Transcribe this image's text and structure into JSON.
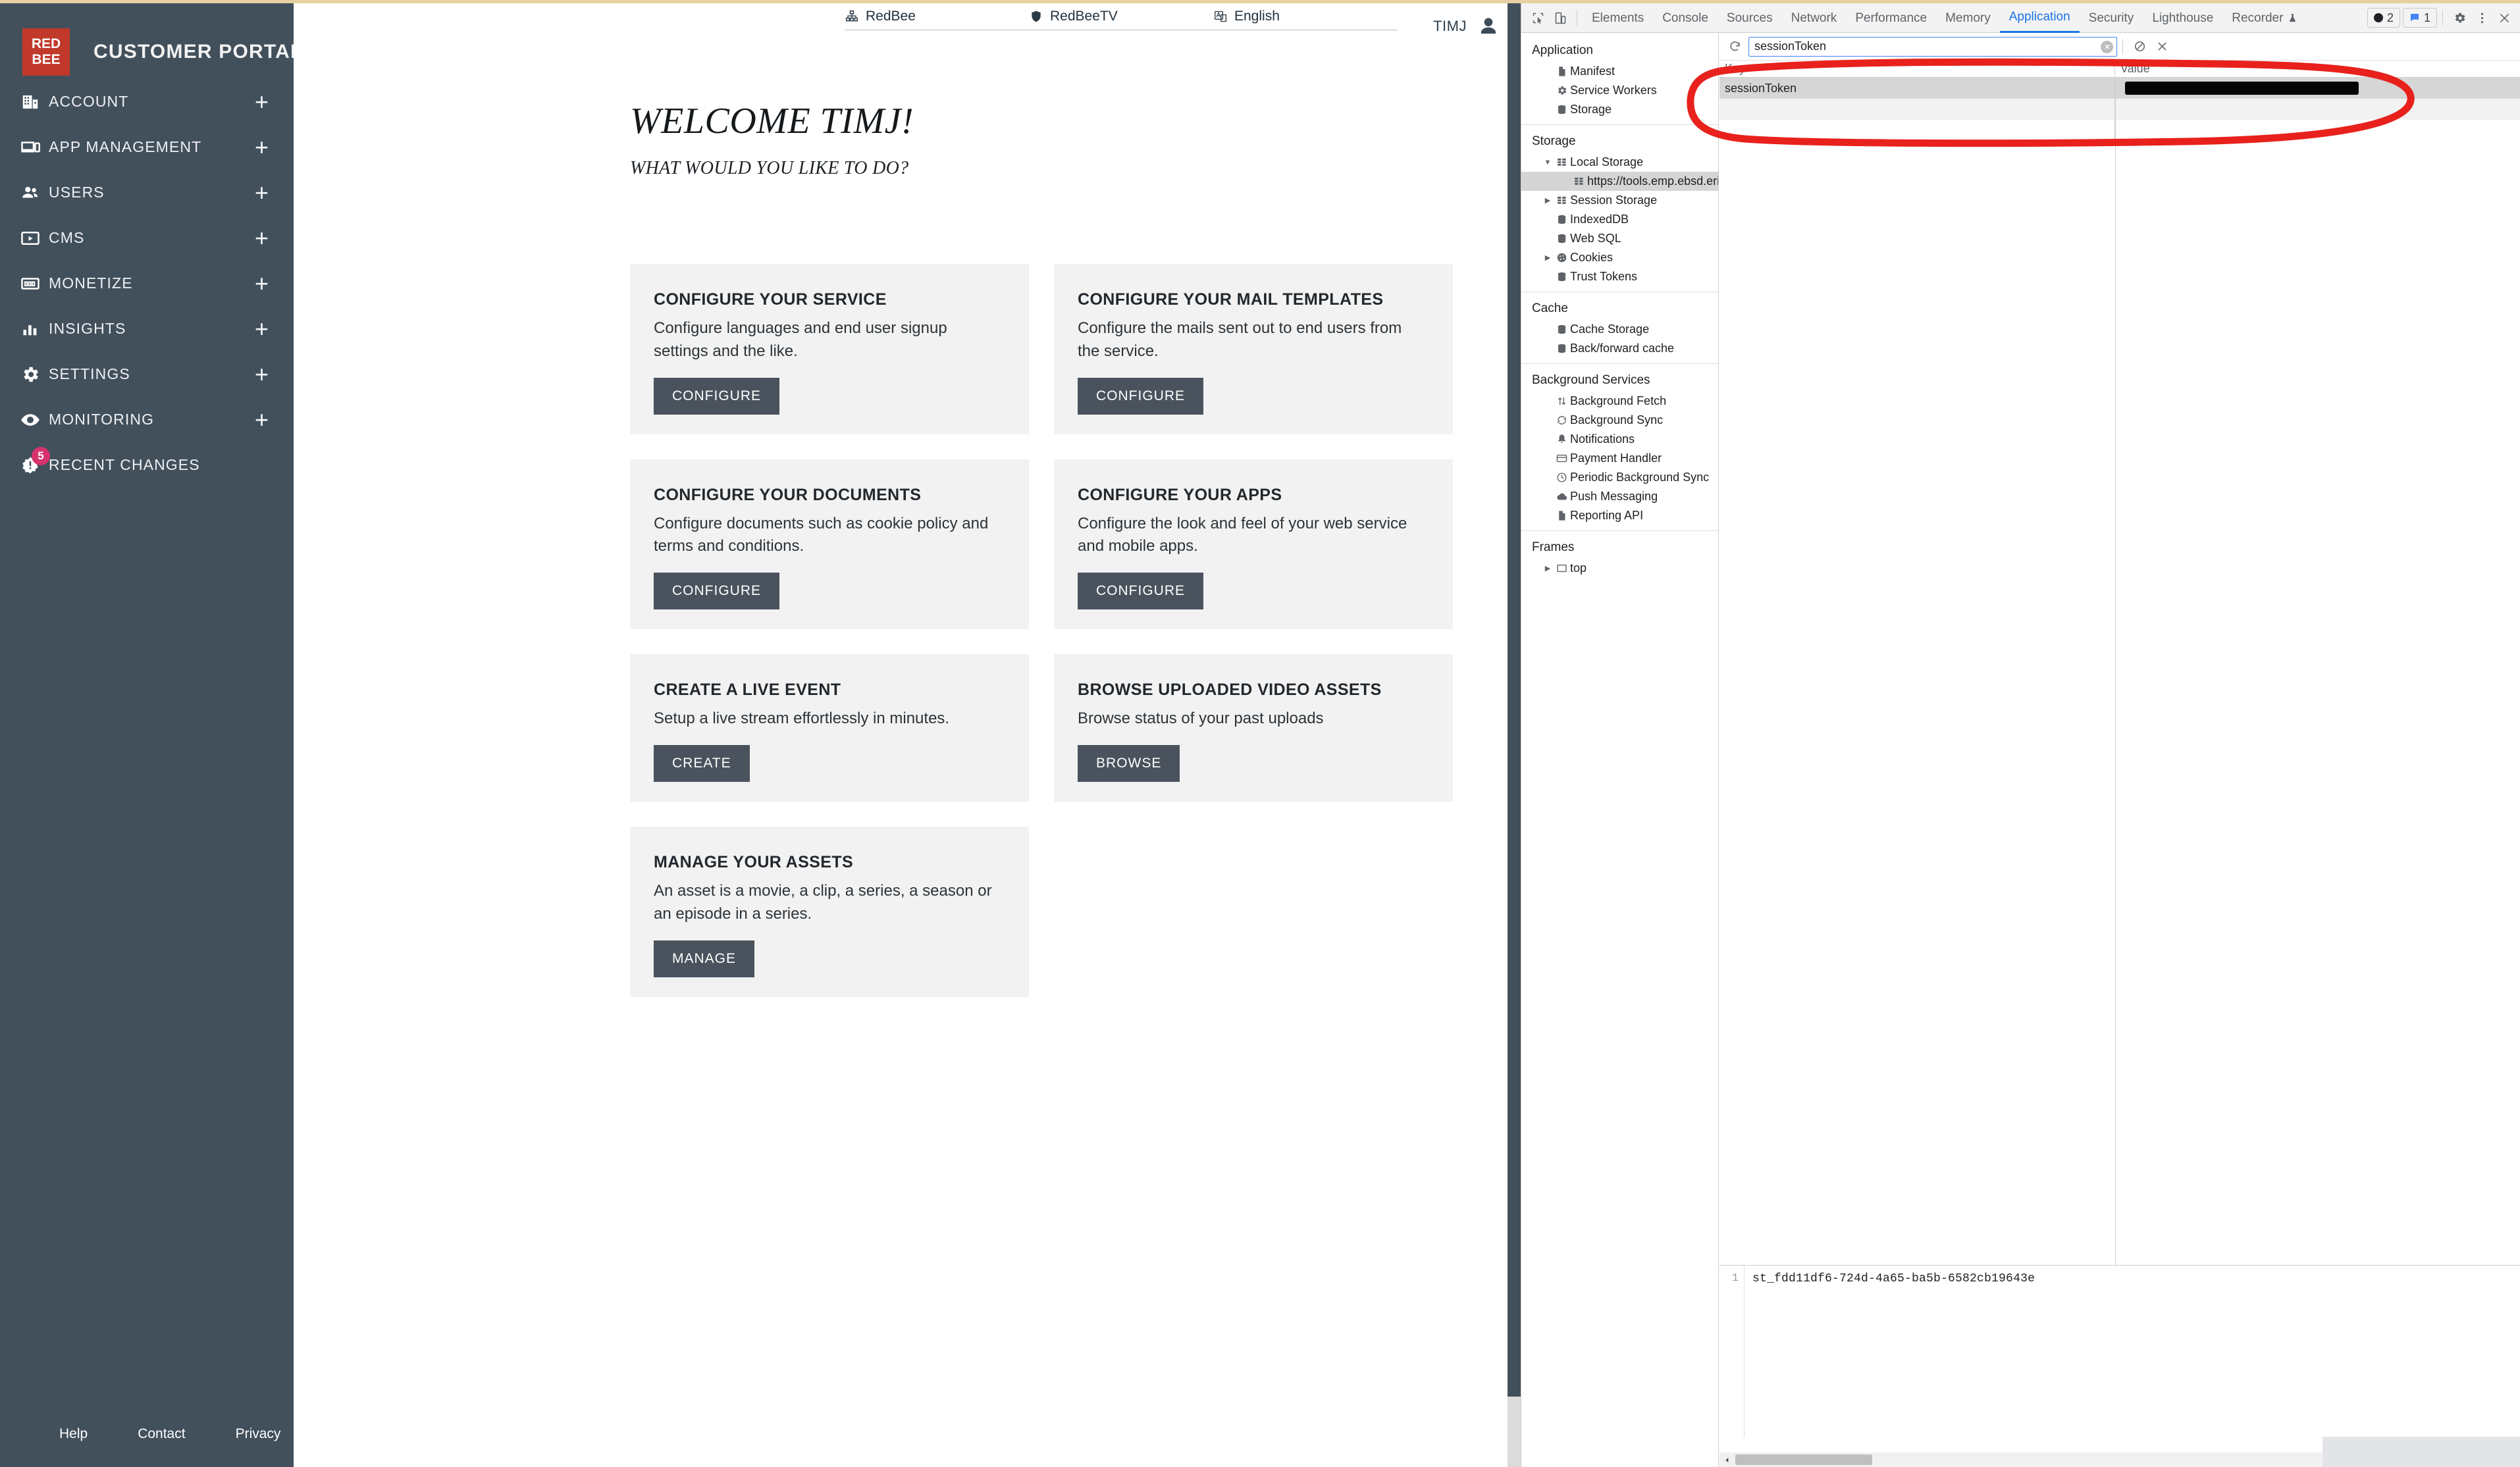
{
  "brand": {
    "logo_line1": "RED",
    "logo_line2": "BEE",
    "title": "CUSTOMER PORTAL",
    "accent_color": "#c0392b",
    "sidebar_color": "#42505c"
  },
  "sidebar": {
    "items": [
      {
        "label": "ACCOUNT",
        "icon": "building-icon",
        "expandable": true,
        "badge": null
      },
      {
        "label": "APP MANAGEMENT",
        "icon": "devices-icon",
        "expandable": true,
        "badge": null
      },
      {
        "label": "USERS",
        "icon": "people-icon",
        "expandable": true,
        "badge": null
      },
      {
        "label": "CMS",
        "icon": "video-icon",
        "expandable": true,
        "badge": null
      },
      {
        "label": "MONETIZE",
        "icon": "banknote-icon",
        "expandable": true,
        "badge": null
      },
      {
        "label": "INSIGHTS",
        "icon": "bar-chart-icon",
        "expandable": true,
        "badge": null
      },
      {
        "label": "SETTINGS",
        "icon": "gear-icon",
        "expandable": true,
        "badge": null
      },
      {
        "label": "MONITORING",
        "icon": "eye-icon",
        "expandable": true,
        "badge": null
      },
      {
        "label": "RECENT CHANGES",
        "icon": "alert-badge-icon",
        "expandable": false,
        "badge": "5"
      }
    ],
    "expand_symbol": "+",
    "footer_links": [
      "Help",
      "Contact",
      "Privacy"
    ]
  },
  "topbar": {
    "selects": [
      {
        "label": "RedBee",
        "icon": "org-tree-icon"
      },
      {
        "label": "RedBeeTV",
        "icon": "shield-icon"
      },
      {
        "label": "English",
        "icon": "language-icon"
      }
    ],
    "user_name": "TIMJ",
    "user_icon": "avatar-icon"
  },
  "main": {
    "heading": "WELCOME TIMJ!",
    "subheading": "WHAT WOULD YOU LIKE TO DO?",
    "cards": [
      {
        "title": "CONFIGURE YOUR SERVICE",
        "desc": "Configure languages and end user signup settings and the like.",
        "button": "CONFIGURE"
      },
      {
        "title": "CONFIGURE YOUR MAIL TEMPLATES",
        "desc": "Configure the mails sent out to end users from the service.",
        "button": "CONFIGURE"
      },
      {
        "title": "CONFIGURE YOUR DOCUMENTS",
        "desc": "Configure documents such as cookie policy and terms and conditions.",
        "button": "CONFIGURE"
      },
      {
        "title": "CONFIGURE YOUR APPS",
        "desc": "Configure the look and feel of your web service and mobile apps.",
        "button": "CONFIGURE"
      },
      {
        "title": "CREATE A LIVE EVENT",
        "desc": "Setup a live stream effortlessly in minutes.",
        "button": "CREATE"
      },
      {
        "title": "BROWSE UPLOADED VIDEO ASSETS",
        "desc": "Browse status of your past uploads",
        "button": "BROWSE"
      },
      {
        "title": "MANAGE YOUR ASSETS",
        "desc": "An asset is a movie, a clip, a series, a season or an episode in a series.",
        "button": "MANAGE"
      }
    ]
  },
  "devtools": {
    "tabs": [
      {
        "label": "Elements",
        "active": false
      },
      {
        "label": "Console",
        "active": false
      },
      {
        "label": "Sources",
        "active": false
      },
      {
        "label": "Network",
        "active": false
      },
      {
        "label": "Performance",
        "active": false
      },
      {
        "label": "Memory",
        "active": false
      },
      {
        "label": "Application",
        "active": true
      },
      {
        "label": "Security",
        "active": false
      },
      {
        "label": "Lighthouse",
        "active": false
      },
      {
        "label": "Recorder",
        "active": false
      }
    ],
    "recorder_suffix_icon": "flask-icon",
    "error_count": "2",
    "message_count": "1",
    "active_tab_color": "#1a73e8",
    "toolbar_icons": [
      "inspect-element-icon",
      "device-toolbar-icon",
      "settings-gear-icon",
      "more-options-icon",
      "close-icon"
    ],
    "tree": [
      {
        "type": "header",
        "label": "Application"
      },
      {
        "type": "item",
        "label": "Manifest",
        "icon": "document-icon",
        "indent": 1,
        "twisty": "",
        "selected": false
      },
      {
        "type": "item",
        "label": "Service Workers",
        "icon": "gear-icon",
        "indent": 1,
        "twisty": "",
        "selected": false
      },
      {
        "type": "item",
        "label": "Storage",
        "icon": "database-icon",
        "indent": 1,
        "twisty": "",
        "selected": false
      },
      {
        "type": "divider"
      },
      {
        "type": "header",
        "label": "Storage"
      },
      {
        "type": "item",
        "label": "Local Storage",
        "icon": "table-icon",
        "indent": 1,
        "twisty": "▼",
        "selected": false
      },
      {
        "type": "item",
        "label": "https://tools.emp.ebsd.erics",
        "icon": "table-icon",
        "indent": 2,
        "twisty": "",
        "selected": true
      },
      {
        "type": "item",
        "label": "Session Storage",
        "icon": "table-icon",
        "indent": 1,
        "twisty": "▶",
        "selected": false
      },
      {
        "type": "item",
        "label": "IndexedDB",
        "icon": "database-icon",
        "indent": 1,
        "twisty": "",
        "selected": false
      },
      {
        "type": "item",
        "label": "Web SQL",
        "icon": "database-icon",
        "indent": 1,
        "twisty": "",
        "selected": false
      },
      {
        "type": "item",
        "label": "Cookies",
        "icon": "cookie-icon",
        "indent": 1,
        "twisty": "▶",
        "selected": false
      },
      {
        "type": "item",
        "label": "Trust Tokens",
        "icon": "database-icon",
        "indent": 1,
        "twisty": "",
        "selected": false
      },
      {
        "type": "divider"
      },
      {
        "type": "header",
        "label": "Cache"
      },
      {
        "type": "item",
        "label": "Cache Storage",
        "icon": "database-icon",
        "indent": 1,
        "twisty": "",
        "selected": false
      },
      {
        "type": "item",
        "label": "Back/forward cache",
        "icon": "database-icon",
        "indent": 1,
        "twisty": "",
        "selected": false
      },
      {
        "type": "divider"
      },
      {
        "type": "header",
        "label": "Background Services"
      },
      {
        "type": "item",
        "label": "Background Fetch",
        "icon": "updown-arrows-icon",
        "indent": 1,
        "twisty": "",
        "selected": false
      },
      {
        "type": "item",
        "label": "Background Sync",
        "icon": "sync-icon",
        "indent": 1,
        "twisty": "",
        "selected": false
      },
      {
        "type": "item",
        "label": "Notifications",
        "icon": "bell-icon",
        "indent": 1,
        "twisty": "",
        "selected": false
      },
      {
        "type": "item",
        "label": "Payment Handler",
        "icon": "credit-card-icon",
        "indent": 1,
        "twisty": "",
        "selected": false
      },
      {
        "type": "item",
        "label": "Periodic Background Sync",
        "icon": "clock-icon",
        "indent": 1,
        "twisty": "",
        "selected": false
      },
      {
        "type": "item",
        "label": "Push Messaging",
        "icon": "cloud-icon",
        "indent": 1,
        "twisty": "",
        "selected": false
      },
      {
        "type": "item",
        "label": "Reporting API",
        "icon": "document-icon",
        "indent": 1,
        "twisty": "",
        "selected": false
      },
      {
        "type": "divider"
      },
      {
        "type": "header",
        "label": "Frames"
      },
      {
        "type": "item",
        "label": "top",
        "icon": "frame-icon",
        "indent": 1,
        "twisty": "▶",
        "selected": false
      }
    ],
    "storage_panel": {
      "refresh_icon": "refresh-icon",
      "filter_value": "sessionToken",
      "filter_clear_icon": "clear-input-icon",
      "clear_all_icon": "block-icon",
      "delete_icon": "delete-x-icon",
      "columns": [
        "Key",
        "Value"
      ],
      "rows": [
        {
          "key": "sessionToken",
          "value": "",
          "value_redacted": true,
          "selected": true
        }
      ],
      "preview_line_number": "1",
      "preview_value": "st_fdd11df6-724d-4a65-ba5b-6582cb19643e"
    }
  },
  "annotation": {
    "shape": "ellipse",
    "color": "#e8211c",
    "target": "sessionToken local storage row"
  }
}
